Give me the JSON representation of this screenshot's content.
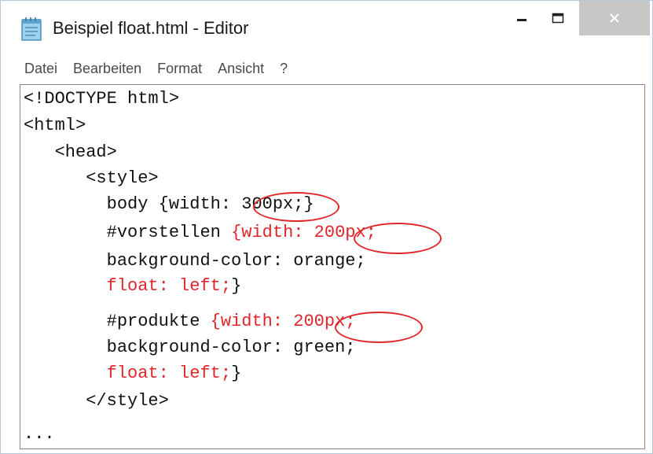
{
  "window": {
    "title": "Beispiel float.html - Editor",
    "controls": {
      "minimize": "–",
      "maximize": "☐",
      "close": "✕"
    }
  },
  "menu": {
    "items": [
      "Datei",
      "Bearbeiten",
      "Format",
      "Ansicht",
      "?"
    ]
  },
  "editor": {
    "lines": [
      {
        "indent": "",
        "parts": [
          {
            "text": "<!DOCTYPE html>",
            "color": "black"
          }
        ]
      },
      {
        "indent": "",
        "parts": [
          {
            "text": "<html>",
            "color": "black"
          }
        ]
      },
      {
        "indent": "   ",
        "parts": [
          {
            "text": "<head>",
            "color": "black"
          }
        ]
      },
      {
        "indent": "      ",
        "parts": [
          {
            "text": "<style>",
            "color": "black"
          }
        ]
      },
      {
        "indent": "        ",
        "parts": [
          {
            "text": "body {width: 300px;}",
            "color": "black"
          }
        ]
      },
      {
        "indent": "        ",
        "parts": [
          {
            "text": "#vorstellen ",
            "color": "black"
          },
          {
            "text": "{width: 200px;",
            "color": "red"
          }
        ]
      },
      {
        "indent": "        ",
        "parts": [
          {
            "text": "background-color: orange;",
            "color": "black"
          }
        ]
      },
      {
        "indent": "        ",
        "parts": [
          {
            "text": "float: left;",
            "color": "red"
          },
          {
            "text": "}",
            "color": "black"
          }
        ]
      },
      {
        "indent": "        ",
        "parts": [
          {
            "text": "#produkte ",
            "color": "black"
          },
          {
            "text": "{width: 200px;",
            "color": "red"
          }
        ]
      },
      {
        "indent": "        ",
        "parts": [
          {
            "text": "background-color: green;",
            "color": "black"
          }
        ]
      },
      {
        "indent": "        ",
        "parts": [
          {
            "text": "float: left;",
            "color": "red"
          },
          {
            "text": "}",
            "color": "black"
          }
        ]
      },
      {
        "indent": "      ",
        "parts": [
          {
            "text": "</style>",
            "color": "black"
          }
        ]
      },
      {
        "indent": "",
        "parts": [
          {
            "text": "...",
            "color": "black"
          }
        ]
      }
    ]
  },
  "colors": {
    "highlight": "#e0262b",
    "text": "#111111",
    "close_button": "#c7c7c7"
  }
}
